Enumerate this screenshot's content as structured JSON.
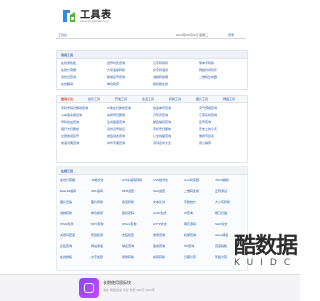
{
  "header": {
    "title": "工具表",
    "url": "www.gongjubiao.com"
  },
  "topbar": {
    "home": "工具表",
    "date": "2024年05月22日  星期三",
    "login": "登录"
  },
  "common": {
    "title": "常用工具",
    "items": [
      "在线调色板",
      "世界时区查询",
      "汉字转拼音",
      "繁体字转换",
      "在线计算器",
      "大写金额转换",
      "文字转语音",
      "网络时间同步",
      "身份证查询",
      "邮编区号查询",
      "进制转换器",
      "二维码生成器",
      "在线翻译",
      "单位换算",
      "随机数生成"
    ]
  },
  "tabs": {
    "labels": [
      "查询工具",
      "站长工具",
      "开发工具",
      "生活工具",
      "转换工具",
      "图片工具",
      "网络工具"
    ]
  },
  "query": {
    "items": [
      "手机号码归属地查询",
      "IP地址归属地查询",
      "快递单号查询",
      "天气预报查询",
      "火车票余票查询",
      "车牌号归属地",
      "万年历查询",
      "汇率实时查询",
      "号码吉凶查询",
      "生肖星座查询",
      "邮政编码查询",
      "区号查询",
      "银行卡归属地",
      "身份证号验证",
      "手机号归属地",
      "历史上的今天",
      "全国电话区号",
      "航班动态查询",
      "公交线路查询",
      "电视节目表",
      "成语词典查询",
      "中华字典查询",
      "诗词名句大全",
      "周公解梦"
    ]
  },
  "online": {
    "title": "在线工具",
    "items": [
      "在线计算器",
      "JS格式化",
      "HTML编码转换",
      "CSS格式化",
      "Unix时间戳",
      "JSON解析",
      "Base64编码",
      "URL编码",
      "MD5加密",
      "SHA加密",
      "二维码生成",
      "正则测试",
      "图片压缩",
      "图片转换",
      "色值转换",
      "文本比对",
      "字数统计",
      "大小写转换",
      "进制转换",
      "单位换算",
      "随机密码",
      "UUID生成",
      "IP查询",
      "端口扫描",
      "PING检测",
      "DNS查询",
      "Whois查询",
      "HTTP状态",
      "网页源码",
      "SEO综合",
      "关键词密度",
      "死链检测",
      "友链检查",
      "收录查询",
      "权重查询",
      "Alexa排名",
      "反链查询",
      "网站测速",
      "域名查询",
      "备案查询",
      "PR查询",
      "百度指数",
      "在线排版",
      "文字加密",
      "简繁转换",
      "拼音转换",
      "日期计算",
      "年龄计算"
    ]
  },
  "ad": {
    "title": "长期使用国际快",
    "subtitle": "海外 网络加速 平台 免费 200万 2024年"
  },
  "watermark": {
    "text": "酷数据",
    "sub": "KUIDC"
  }
}
